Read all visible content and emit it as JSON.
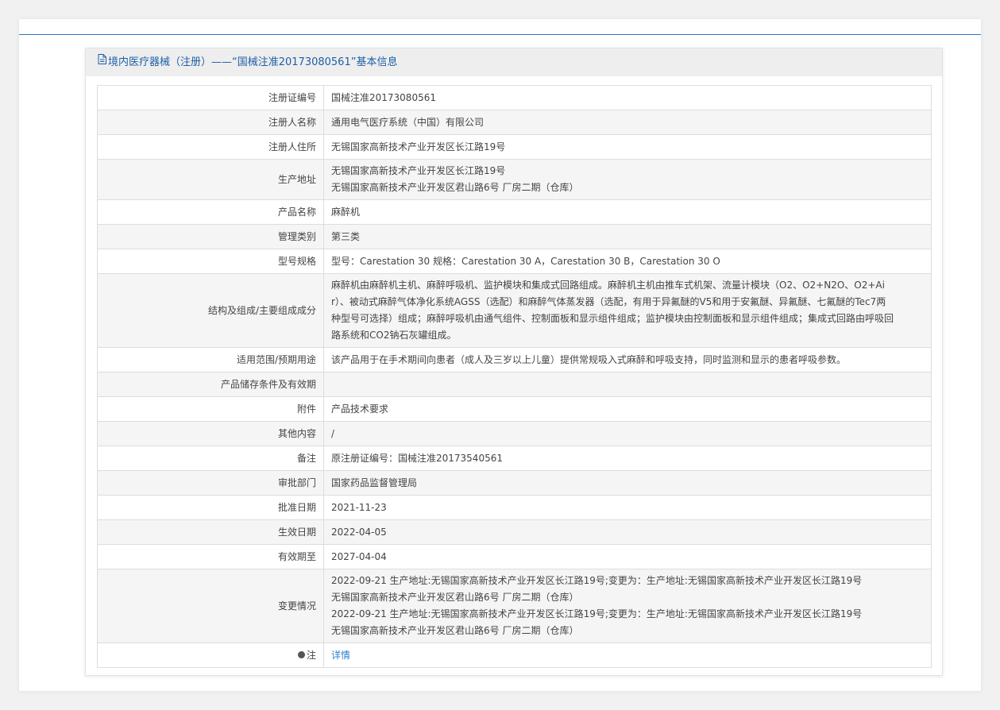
{
  "header": {
    "title": "境内医疗器械（注册）——“国械注准20173080561”基本信息"
  },
  "rows": [
    {
      "label": "注册证编号",
      "value": "国械注准20173080561"
    },
    {
      "label": "注册人名称",
      "value": "通用电气医疗系统（中国）有限公司"
    },
    {
      "label": "注册人住所",
      "value": "无锡国家高新技术产业开发区长江路19号"
    },
    {
      "label": "生产地址",
      "lines": [
        "无锡国家高新技术产业开发区长江路19号",
        "无锡国家高新技术产业开发区君山路6号 厂房二期（仓库）"
      ]
    },
    {
      "label": "产品名称",
      "value": "麻醉机"
    },
    {
      "label": "管理类别",
      "value": "第三类"
    },
    {
      "label": "型号规格",
      "value": "型号：Carestation 30 规格：Carestation 30 A，Carestation 30 B，Carestation 30 O"
    },
    {
      "label": "结构及组成/主要组成成分",
      "lines": [
        "麻醉机由麻醉机主机、麻醉呼吸机、监护模块和集成式回路组成。麻醉机主机由推车式机架、流量计模块（O2、O2+N2O、O2+Ai",
        "r）、被动式麻醉气体净化系统AGSS（选配）和麻醉气体蒸发器（选配，有用于异氟醚的V5和用于安氟醚、异氟醚、七氟醚的Tec7两",
        "种型号可选择）组成；麻醉呼吸机由通气组件、控制面板和显示组件组成；监护模块由控制面板和显示组件组成；集成式回路由呼吸回",
        "路系统和CO2钠石灰罐组成。"
      ]
    },
    {
      "label": "适用范围/预期用途",
      "value": "该产品用于在手术期间向患者（成人及三岁以上儿童）提供常规吸入式麻醉和呼吸支持，同时监测和显示的患者呼吸参数。"
    },
    {
      "label": "产品储存条件及有效期",
      "value": ""
    },
    {
      "label": "附件",
      "value": "产品技术要求"
    },
    {
      "label": "其他内容",
      "value": "/"
    },
    {
      "label": "备注",
      "value": "原注册证编号：国械注准20173540561"
    },
    {
      "label": "审批部门",
      "value": "国家药品监督管理局"
    },
    {
      "label": "批准日期",
      "value": "2021-11-23"
    },
    {
      "label": "生效日期",
      "value": "2022-04-05"
    },
    {
      "label": "有效期至",
      "value": "2027-04-04"
    },
    {
      "label": "变更情况",
      "lines": [
        "2022-09-21 生产地址:无锡国家高新技术产业开发区长江路19号;变更为：生产地址:无锡国家高新技术产业开发区长江路19号",
        "无锡国家高新技术产业开发区君山路6号 厂房二期（仓库）",
        "2022-09-21 生产地址:无锡国家高新技术产业开发区长江路19号;变更为：生产地址:无锡国家高新技术产业开发区长江路19号",
        "无锡国家高新技术产业开发区君山路6号 厂房二期（仓库）"
      ]
    }
  ],
  "note": {
    "label": "注",
    "link_text": "详情"
  },
  "colors": {
    "accent": "#2c73c3",
    "header_text": "#1d5fa6",
    "link": "#2c7fd1"
  }
}
